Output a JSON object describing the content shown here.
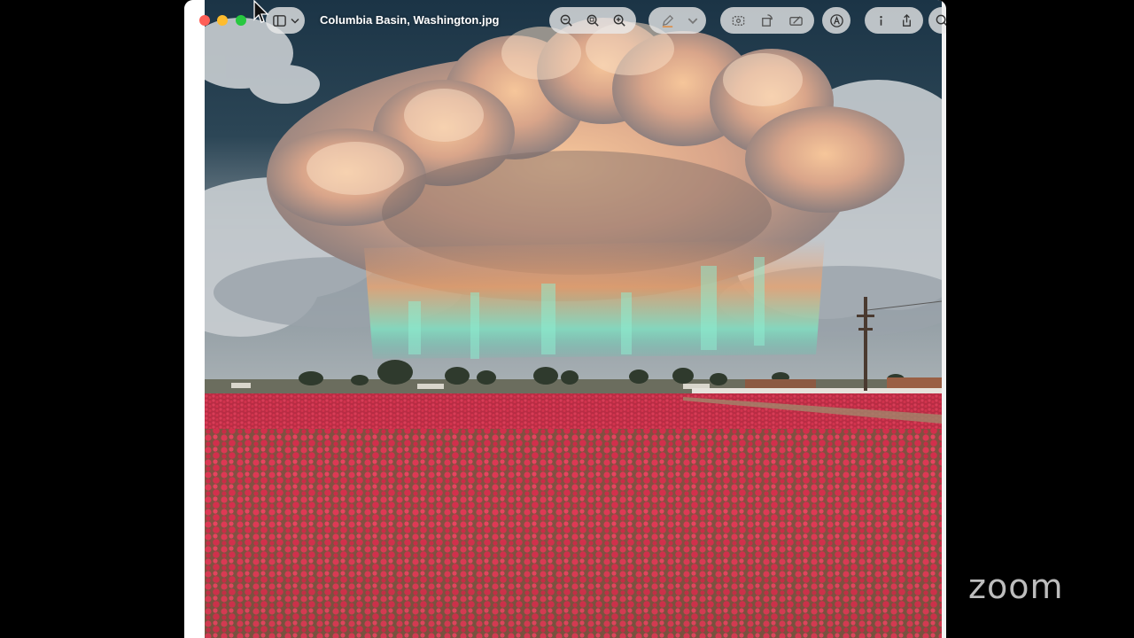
{
  "window": {
    "title": "Columbia Basin, Washington.jpg"
  },
  "toolbar": {
    "traffic_lights": [
      "close",
      "minimize",
      "zoom"
    ],
    "buttons": [
      {
        "icon": "sidebar-toggle-icon"
      },
      {
        "icon": "zoom-out-icon"
      },
      {
        "icon": "zoom-fit-icon"
      },
      {
        "icon": "zoom-in-icon"
      },
      {
        "icon": "markup-pen-icon"
      },
      {
        "icon": "chevron-down-icon"
      },
      {
        "icon": "select-area-icon"
      },
      {
        "icon": "rotate-icon"
      },
      {
        "icon": "crop-icon"
      },
      {
        "icon": "annotate-circle-icon"
      },
      {
        "icon": "info-icon"
      },
      {
        "icon": "share-icon"
      },
      {
        "icon": "search-icon"
      }
    ]
  },
  "overlay": {
    "zoom_logo": "zoom"
  },
  "colors": {
    "sky": "#1f3a4a",
    "flowers": "#d8324a",
    "cloud_glow": "#f0b890",
    "aurora": "#6fe0c0"
  }
}
